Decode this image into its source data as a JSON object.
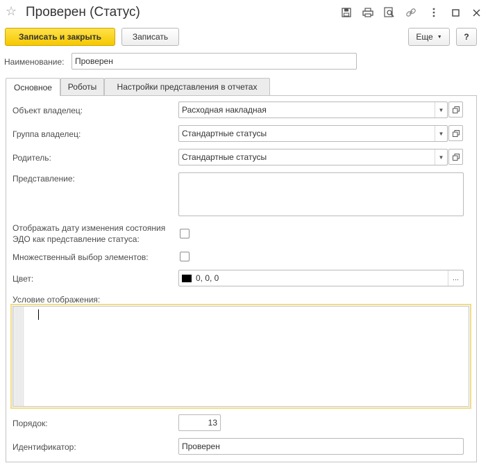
{
  "window": {
    "title": "Проверен (Статус)",
    "icons": [
      "star-icon",
      "save-icon",
      "print-icon",
      "preview-icon",
      "link-icon",
      "more-icon",
      "maximize-icon",
      "close-icon"
    ]
  },
  "toolbar": {
    "save_close_label": "Записать и закрыть",
    "save_label": "Записать",
    "more_label": "Еще",
    "help_label": "?"
  },
  "name": {
    "label": "Наименование:",
    "value": "Проверен"
  },
  "tabs": [
    {
      "label": "Основное",
      "active": true
    },
    {
      "label": "Роботы",
      "active": false
    },
    {
      "label": "Настройки представления в отчетах",
      "active": false
    }
  ],
  "form": {
    "owner_object": {
      "label": "Объект владелец:",
      "value": "Расходная накладная"
    },
    "owner_group": {
      "label": "Группа владелец:",
      "value": "Стандартные статусы"
    },
    "parent": {
      "label": "Родитель:",
      "value": "Стандартные статусы"
    },
    "presentation": {
      "label": "Представление:",
      "value": ""
    },
    "show_edo_date": {
      "label_line1": "Отображать дату изменения состояния",
      "label_line2": "ЭДО как представление статуса:",
      "checked": false
    },
    "multi_select": {
      "label": "Множественный выбор элементов:",
      "checked": false
    },
    "color": {
      "label": "Цвет:",
      "value": "0, 0, 0",
      "swatch": "#000000",
      "button": "..."
    },
    "condition": {
      "label": "Условие отображения:",
      "value": ""
    },
    "order": {
      "label": "Порядок:",
      "value": "13"
    },
    "identifier": {
      "label": "Идентификатор:",
      "value": "Проверен"
    }
  },
  "colors": {
    "primary_button": "#f5c800",
    "focus_border": "#f1dc86",
    "border": "#b9b9b9"
  }
}
